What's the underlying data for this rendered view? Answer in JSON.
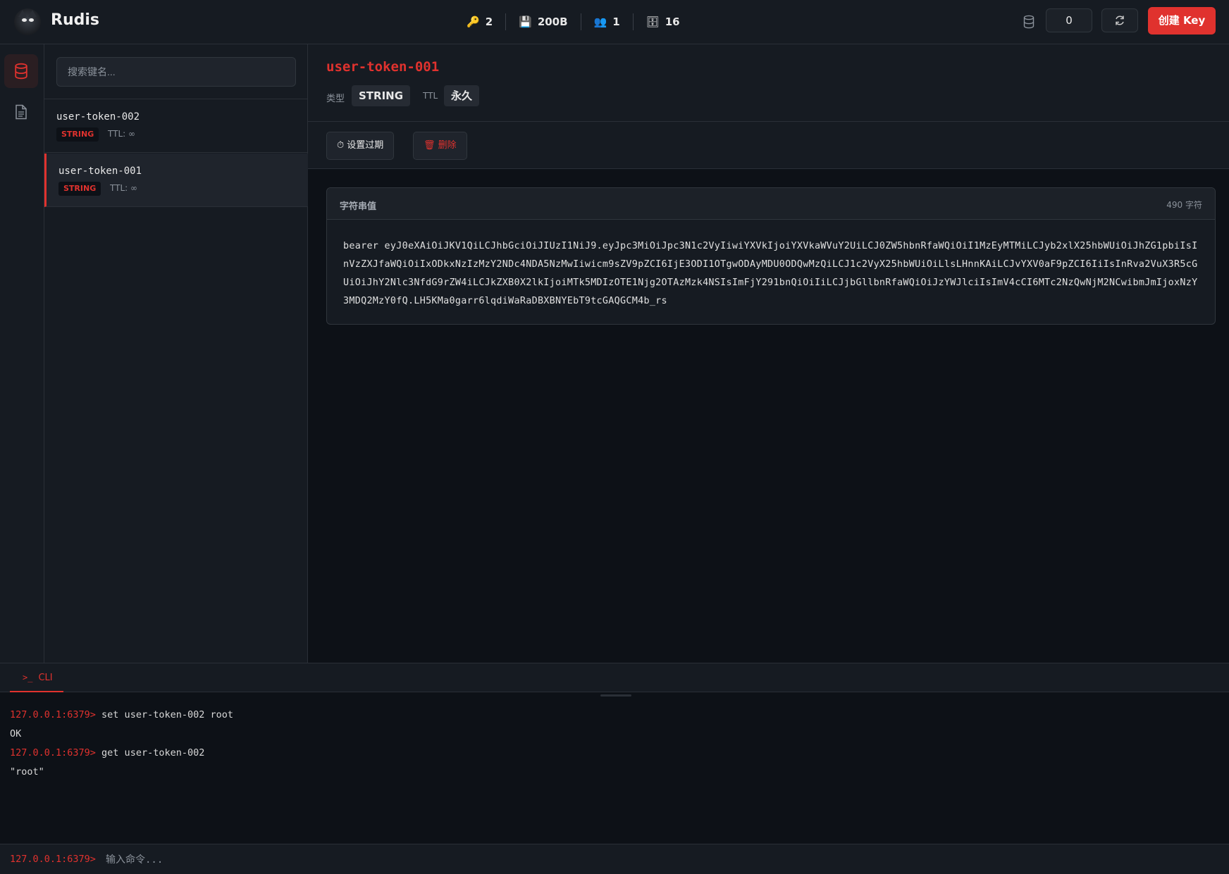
{
  "header": {
    "app_title": "Rudis",
    "stats": [
      {
        "icon": "key-icon",
        "glyph": "🔑",
        "value": "2"
      },
      {
        "icon": "floppy-disk-icon",
        "glyph": "💾",
        "value": "200B"
      },
      {
        "icon": "users-icon",
        "glyph": "👥",
        "value": "1"
      },
      {
        "icon": "memory-chip-icon",
        "glyph": "🗄",
        "value": "16"
      }
    ],
    "db_index": "0",
    "create_button": "创建 Key"
  },
  "keylist": {
    "search_placeholder": "搜索键名...",
    "items": [
      {
        "name": "user-token-002",
        "type": "STRING",
        "ttl": "TTL: ∞"
      },
      {
        "name": "user-token-001",
        "type": "STRING",
        "ttl": "TTL: ∞",
        "selected": true
      }
    ]
  },
  "detail": {
    "key_name": "user-token-001",
    "type_label": "类型",
    "type_value": "STRING",
    "ttl_label": "TTL",
    "ttl_value": "永久",
    "set_expire_button": "⏱ 设置过期",
    "delete_button": "🗑 删除",
    "value_card_title": "字符串值",
    "value_length": "490 字符",
    "value": "bearer eyJ0eXAiOiJKV1QiLCJhbGciOiJIUzI1NiJ9.eyJpc3MiOiJpc3N1c2VyIiwiYXVkIjoiYXVkaWVuY2UiLCJ0ZW5hbnRfaWQiOiI1MzEyMTMiLCJyb2xlX25hbWUiOiJhZG1pbiIsInVzZXJfaWQiOiIxODkxNzIzMzY2NDc4NDA5NzMwIiwicm9sZV9pZCI6IjE3ODI1OTgwODAyMDU0ODQwMzQiLCJ1c2VyX25hbWUiOiLlsLHnnKAiLCJvYXV0aF9pZCI6IiIsInRva2VuX3R5cGUiOiJhY2Nlc3NfdG9rZW4iLCJkZXB0X2lkIjoiMTk5MDIzOTE1Njg2OTAzMzk4NSIsImFjY291bnQiOiIiLCJjbGllbnRfaWQiOiJzYWJlciIsImV4cCI6MTc2NzQwNjM2NCwibmJmIjoxNzY3MDQ2MzY0fQ.LH5KMa0garr6lqdiWaRaDBXBNYEbT9tcGAQGCM4b_rs"
  },
  "cli": {
    "tab_label": "CLI",
    "lines": [
      {
        "prompt": "127.0.0.1:6379>",
        "text": " set user-token-002 root"
      },
      {
        "prompt": "",
        "text": "OK"
      },
      {
        "prompt": "127.0.0.1:6379>",
        "text": " get user-token-002"
      },
      {
        "prompt": "",
        "text": "\"root\""
      }
    ],
    "input_prompt": "127.0.0.1:6379>",
    "input_placeholder": "输入命令..."
  },
  "colors": {
    "accent": "#e0322e",
    "background": "#0d1117",
    "panel": "#161b22"
  }
}
